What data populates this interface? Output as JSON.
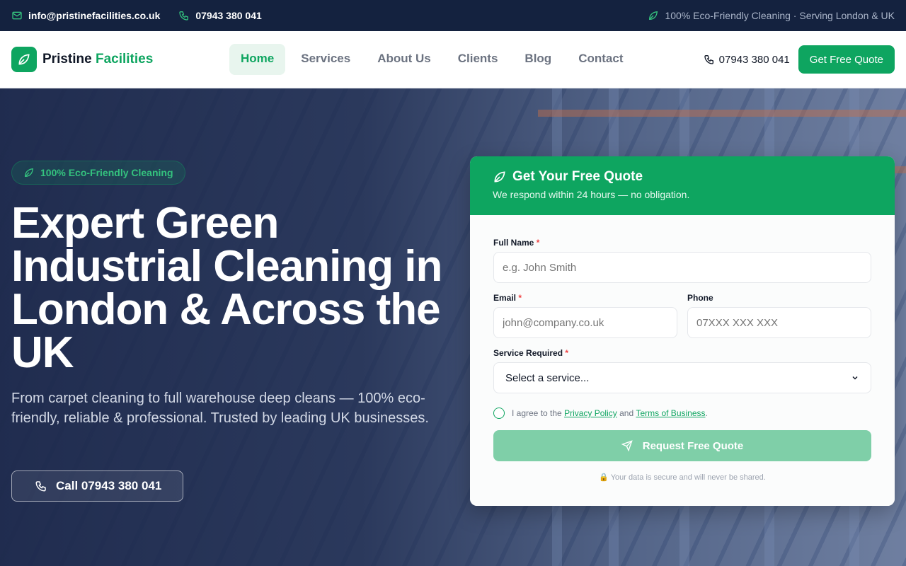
{
  "topbar": {
    "email": "info@pristinefacilities.co.uk",
    "phone": "07943 380 041",
    "tagline": "100% Eco-Friendly Cleaning · Serving London & UK"
  },
  "header": {
    "logo_word1": "Pristine",
    "logo_word2": "Facilities",
    "nav": [
      {
        "label": "Home"
      },
      {
        "label": "Services"
      },
      {
        "label": "About Us"
      },
      {
        "label": "Clients"
      },
      {
        "label": "Blog"
      },
      {
        "label": "Contact"
      }
    ],
    "phone": "07943 380 041",
    "cta": "Get Free Quote"
  },
  "hero": {
    "badge": "100% Eco-Friendly Cleaning",
    "title": "Expert Green Industrial Cleaning in London & Across the UK",
    "subtitle": "From carpet cleaning to full warehouse deep cleans — 100% eco-friendly, reliable & professional. Trusted by leading UK businesses.",
    "call_label": "Call 07943 380 041"
  },
  "form": {
    "title": "Get Your Free Quote",
    "subtitle": "We respond within 24 hours — no obligation.",
    "full_name_label": "Full Name",
    "full_name_placeholder": "e.g. John Smith",
    "email_label": "Email",
    "email_placeholder": "john@company.co.uk",
    "phone_label": "Phone",
    "phone_placeholder": "07XXX XXX XXX",
    "service_label": "Service Required",
    "service_selected": "Select a service...",
    "required_mark": "*",
    "agree_prefix": "I agree to the",
    "privacy_link": "Privacy Policy",
    "agree_and": "and",
    "terms_link": "Terms of Business",
    "agree_suffix": ".",
    "submit": "Request Free Quote",
    "secure_note": "🔒 Your data is secure and will never be shared."
  },
  "colors": {
    "brand_green": "#0ea560",
    "topbar_bg": "#14223f"
  }
}
